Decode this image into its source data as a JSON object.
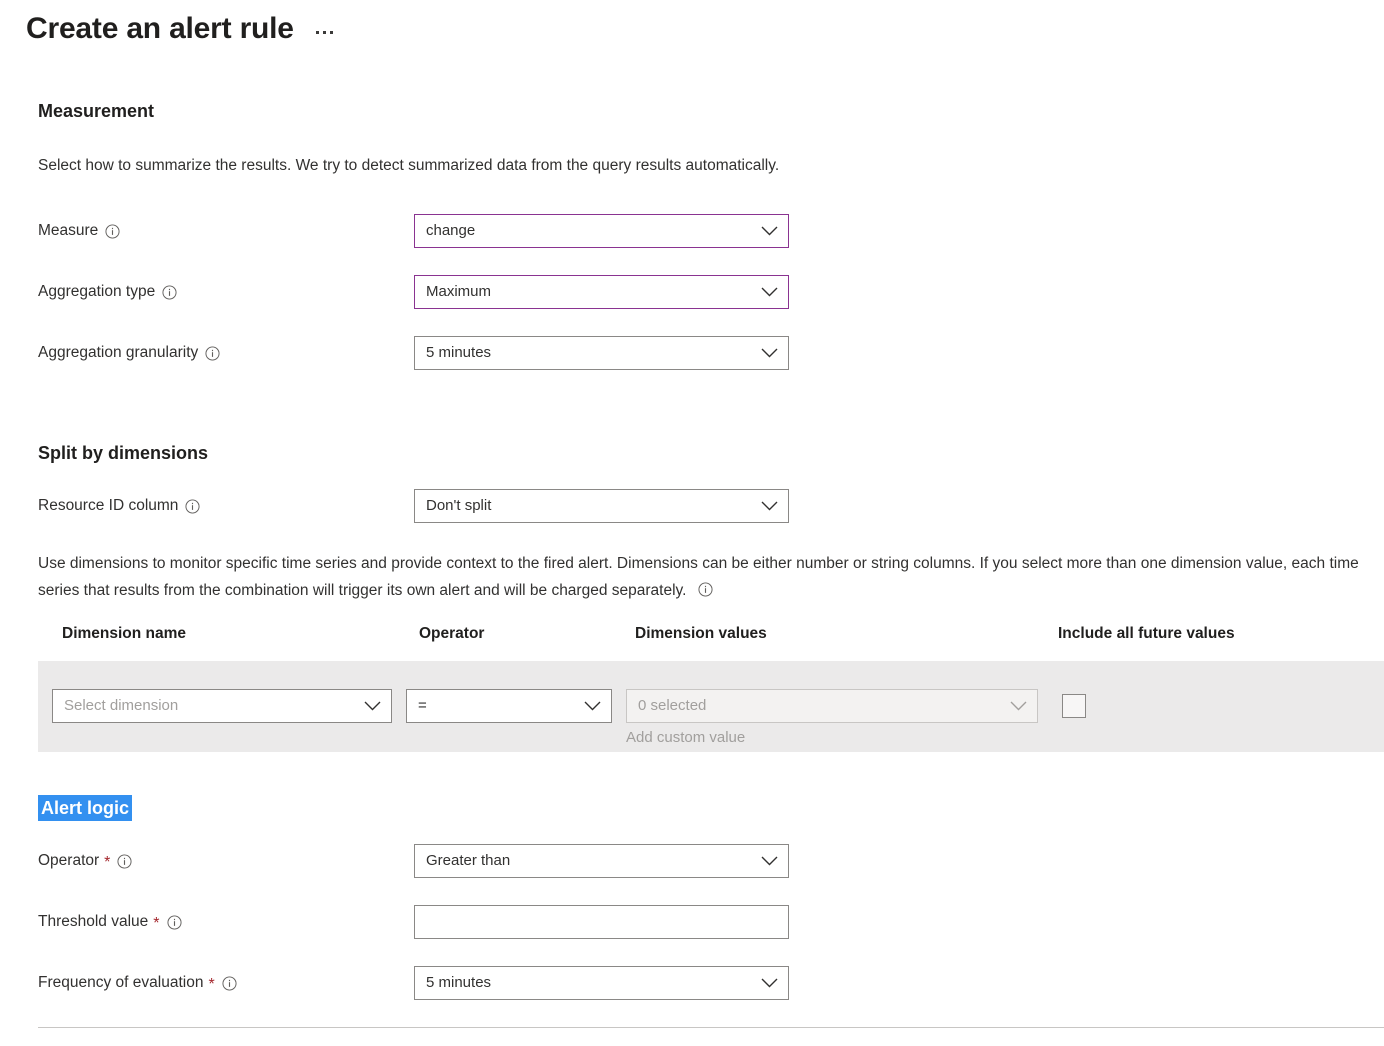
{
  "header": {
    "title": "Create an alert rule",
    "more_menu": "…"
  },
  "measurement": {
    "heading": "Measurement",
    "description": "Select how to summarize the results. We try to detect summarized data from the query results automatically.",
    "fields": [
      {
        "label": "Measure",
        "value": "change",
        "accent": true
      },
      {
        "label": "Aggregation type",
        "value": "Maximum",
        "accent": true
      },
      {
        "label": "Aggregation granularity",
        "value": "5 minutes",
        "accent": false
      }
    ]
  },
  "split_by_dimensions": {
    "heading": "Split by dimensions",
    "resource_id_label": "Resource ID column",
    "resource_id_value": "Don't split",
    "description": "Use dimensions to monitor specific time series and provide context to the fired alert. Dimensions can be either number or string columns. If you select more than one dimension value, each time series that results from the combination will trigger its own alert and will be charged separately.",
    "columns": [
      "Dimension name",
      "Operator",
      "Dimension values",
      "Include all future values"
    ],
    "row": {
      "dimension_name_placeholder": "Select dimension",
      "operator_value": "=",
      "dimension_values_placeholder": "0 selected",
      "add_custom_value": "Add custom value",
      "include_all_future_values_checked": false
    }
  },
  "alert_logic": {
    "heading": "Alert logic",
    "fields": [
      {
        "label": "Operator",
        "required": "*",
        "value": "Greater than",
        "type": "select"
      },
      {
        "label": "Threshold value",
        "required": "*",
        "value": "",
        "type": "text"
      },
      {
        "label": "Frequency of evaluation",
        "required": "*",
        "value": "5 minutes",
        "type": "select"
      }
    ]
  },
  "colors": {
    "accent_border": "#8a3391",
    "selection_highlight": "#3390f0",
    "required_asterisk": "#a4262c",
    "row_background": "#ebeaea"
  }
}
